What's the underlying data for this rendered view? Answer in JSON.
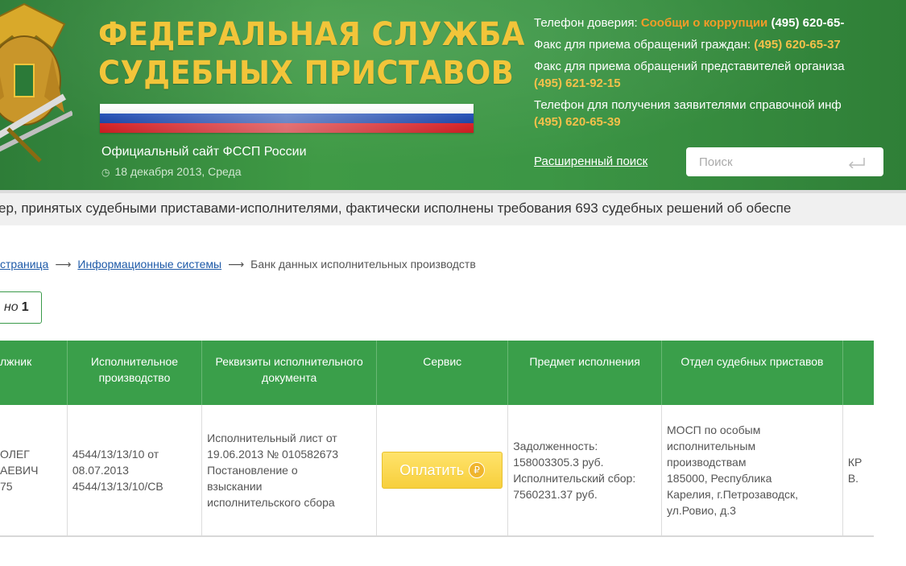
{
  "header": {
    "title_line1": "ФЕДЕРАЛЬНАЯ СЛУЖБА",
    "title_line2": "СУДЕБНЫХ ПРИСТАВОВ",
    "site_name": "Официальный сайт ФССП России",
    "date": "18 декабря 2013, Среда",
    "contacts": {
      "trust_label": "Телефон доверия: ",
      "trust_link": "Сообщи о коррупции",
      "trust_phone": " (495) 620-65-",
      "fax_citizens_label": "Факс для приема обращений граждан: ",
      "fax_citizens_phone": "(495) 620-65-37",
      "fax_org_label": "Факс для приема обращений представителей организа",
      "fax_org_phone": "(495) 621-92-15",
      "info_label": "Телефон для получения заявителями справочной инф",
      "info_phone": "(495) 620-65-39"
    },
    "advanced_search": "Расширенный поиск",
    "search_placeholder": "Поиск"
  },
  "ticker": "ер, принятых судебными приставами-исполнителями, фактически исполнены требования 693 судебных решений об обеспе",
  "breadcrumb": {
    "home": "страница",
    "info_systems": "Информационные системы",
    "current": "Банк данных исполнительных производств",
    "sep": "⟶"
  },
  "found": {
    "label": "но",
    "count": "1"
  },
  "table": {
    "headers": {
      "debtor": "лжник",
      "proceeding": "Исполнительное производство",
      "document": "Реквизиты исполнительного документа",
      "service": "Сервис",
      "subject": "Предмет исполнения",
      "department": "Отдел судебных приставов"
    },
    "row": {
      "debtor": [
        "ОЛЕГ",
        "АЕВИЧ",
        "75"
      ],
      "proceeding": [
        "4544/13/13/10 от",
        "08.07.2013",
        "4544/13/13/10/СВ"
      ],
      "document": [
        "Исполнительный лист от",
        "19.06.2013 № 010582673",
        "Постановление о",
        "взыскании",
        "исполнительского сбора"
      ],
      "pay_label": "Оплатить",
      "rub_symbol": "₽",
      "subject": [
        "Задолженность:",
        "158003305.3 руб.",
        "Исполнительский сбор:",
        "7560231.37 руб."
      ],
      "department": [
        "МОСП по особым",
        "исполнительным",
        "производствам",
        "185000, Республика",
        "Карелия, г.Петрозаводск,",
        "ул.Ровио, д.3"
      ],
      "bailiff": [
        "КР",
        "В."
      ]
    }
  },
  "colors": {
    "header_green": "#3c9645",
    "title_gold": "#f2c53a",
    "table_header_green": "#3a9f4a",
    "corruption_orange": "#f29b28",
    "pay_button_yellow": "#f7cf3c",
    "link_blue": "#1e5aa8"
  }
}
